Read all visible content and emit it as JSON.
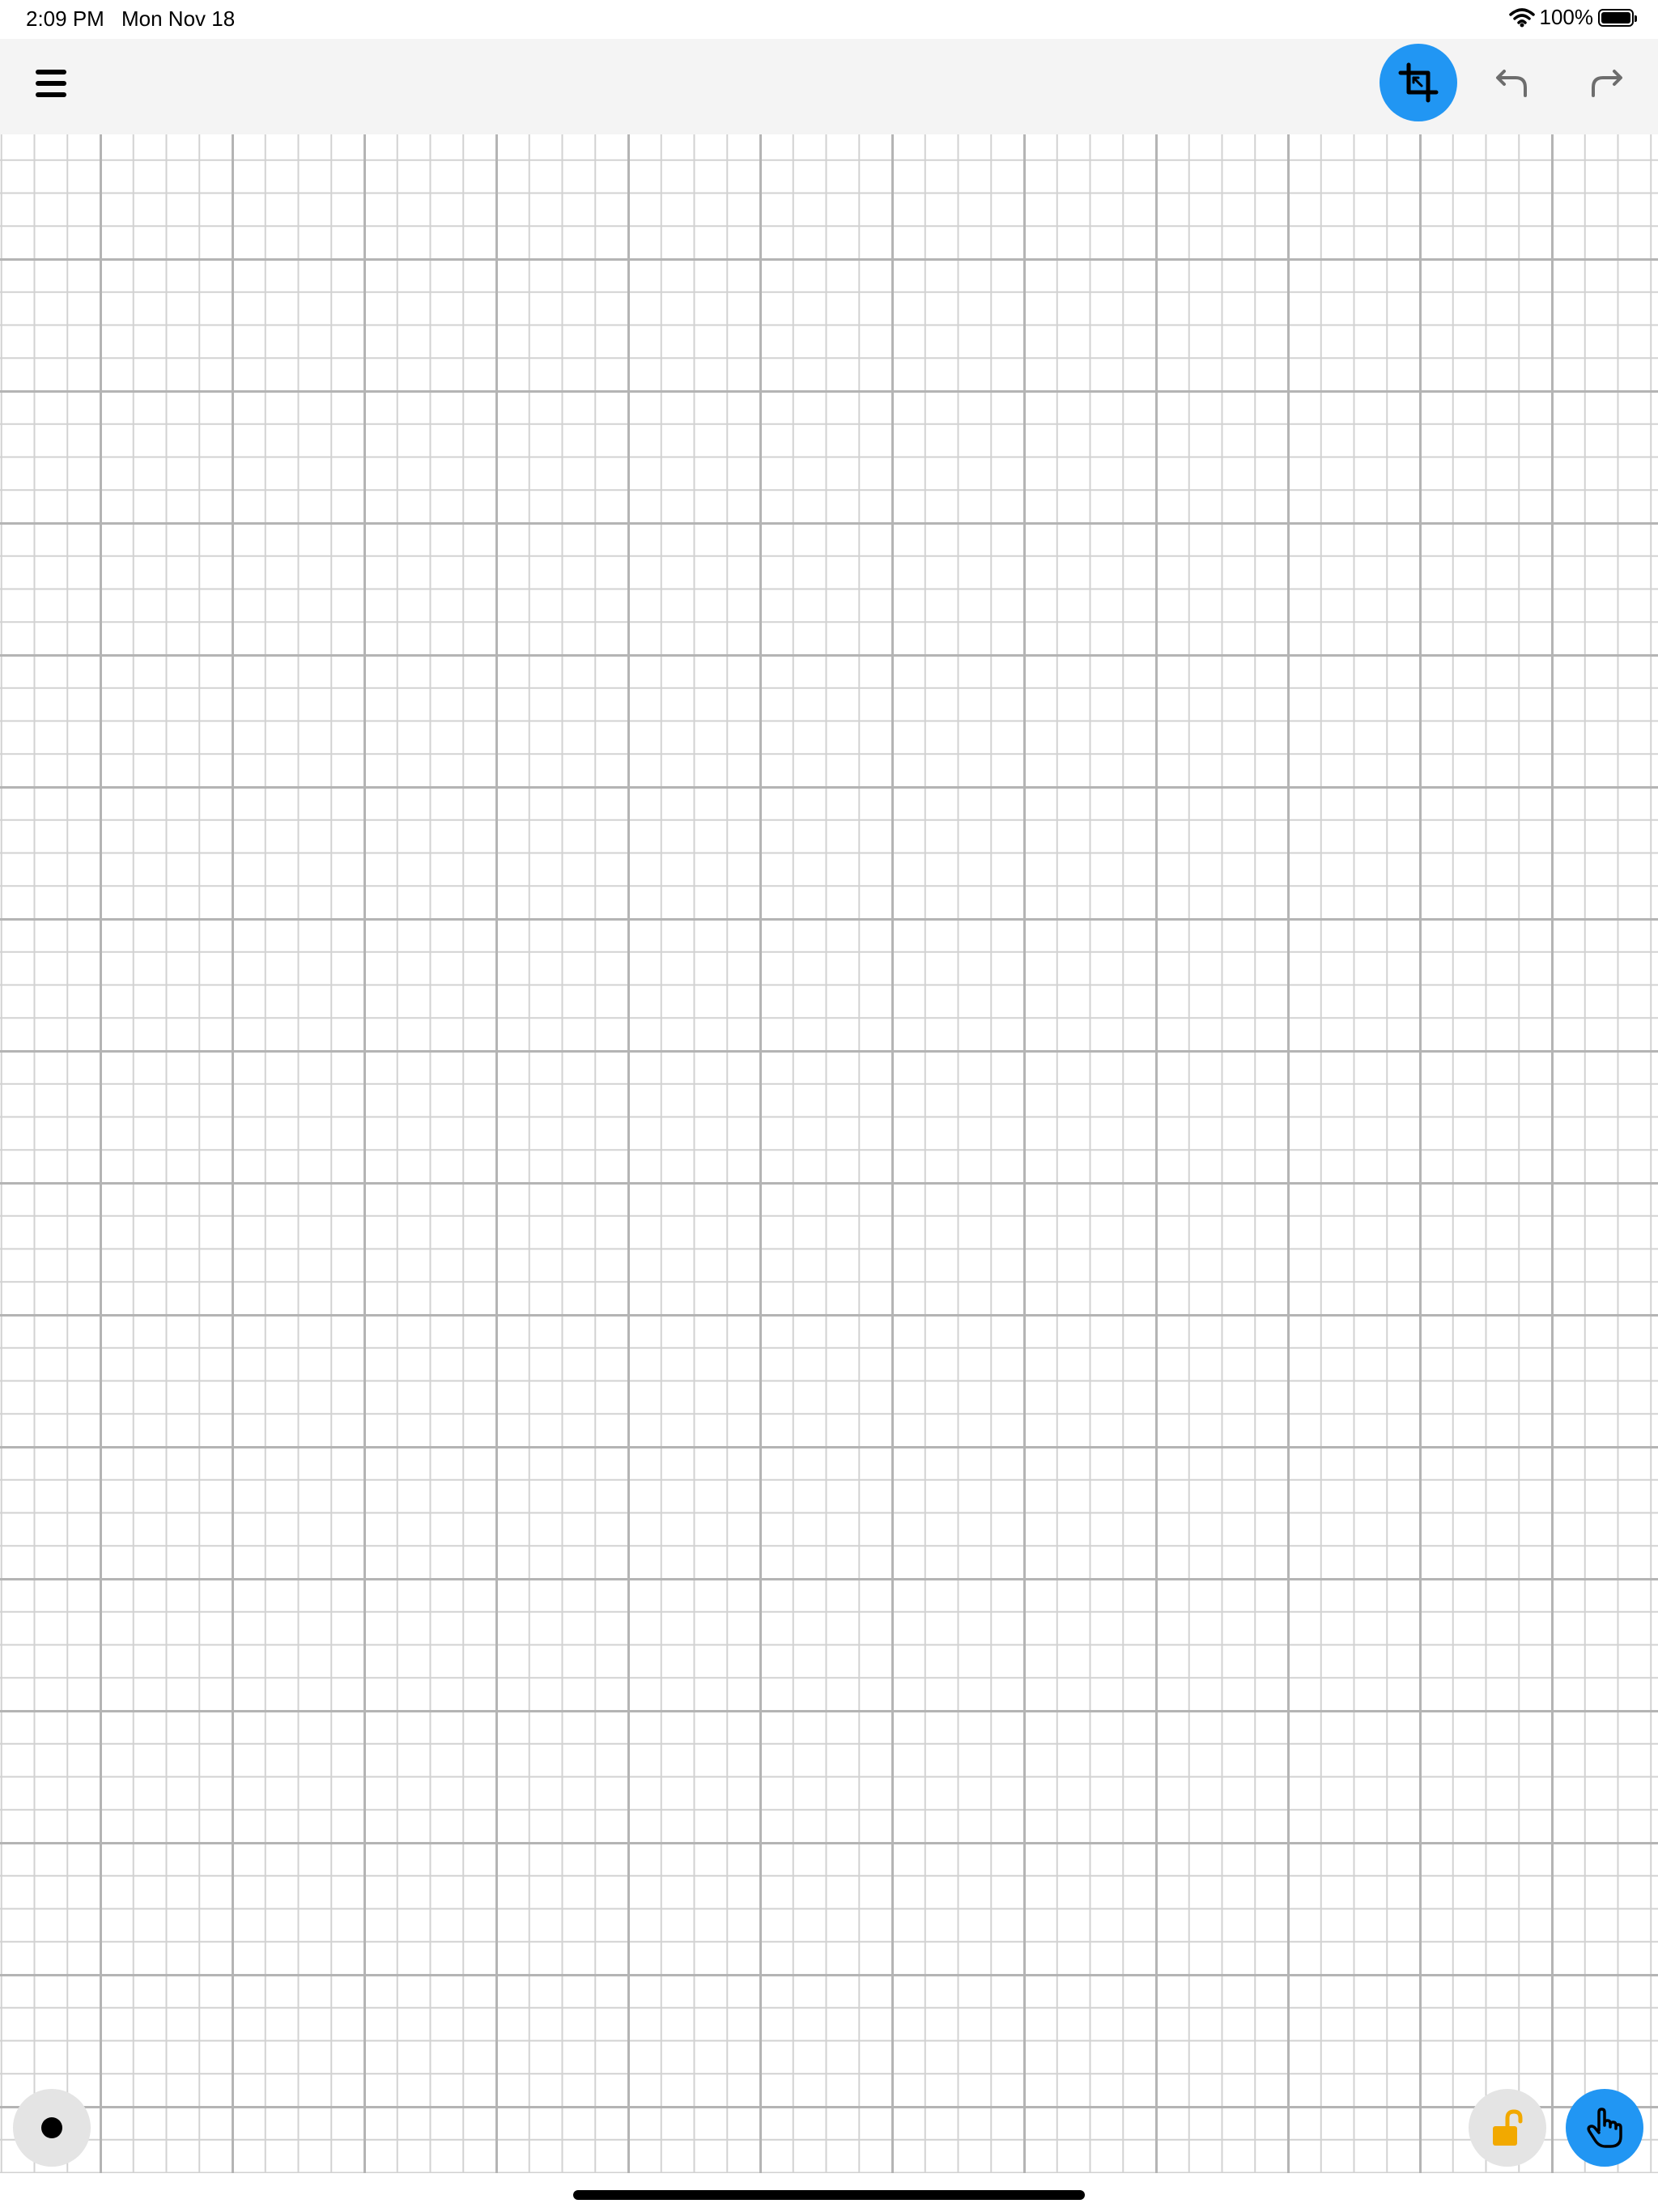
{
  "status_bar": {
    "time": "2:09 PM",
    "date": "Mon Nov 18",
    "battery_percent": "100%",
    "battery_level": 1.0,
    "wifi_icon": "wifi-icon",
    "battery_icon": "battery-icon"
  },
  "toolbar": {
    "menu_icon": "hamburger-menu-icon",
    "crop_icon": "crop-icon",
    "undo_icon": "undo-icon",
    "redo_icon": "redo-icon"
  },
  "canvas": {
    "type": "grid-paper"
  },
  "bottom_controls": {
    "pen_icon": "pen-dot-icon",
    "lock_icon": "unlocked-padlock-icon",
    "touch_icon": "hand-pointer-icon"
  },
  "colors": {
    "accent": "#2196f3",
    "toolbar_bg": "#f4f4f4",
    "lock": "#f2a900",
    "button_gray": "#e4e4e4",
    "grid_major": "#b4b4b4",
    "grid_minor": "#d2d2d2"
  }
}
